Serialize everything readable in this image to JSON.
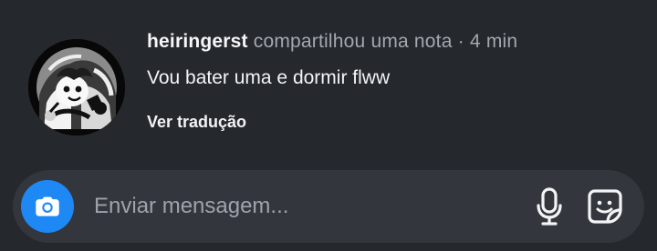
{
  "note": {
    "username": "heiringerst",
    "action": "compartilhou uma nota",
    "separator": "·",
    "time": "4 min",
    "text": "Vou bater uma e dormir flww",
    "translate_label": "Ver tradução"
  },
  "composer": {
    "placeholder": "Enviar mensagem...",
    "camera_icon": "camera-icon",
    "mic_icon": "microphone-icon",
    "sticker_icon": "sticker-icon"
  },
  "colors": {
    "background": "#25282d",
    "composer": "#33373d",
    "accent": "#1e88f5",
    "secondary_text": "#a3a8b0"
  }
}
